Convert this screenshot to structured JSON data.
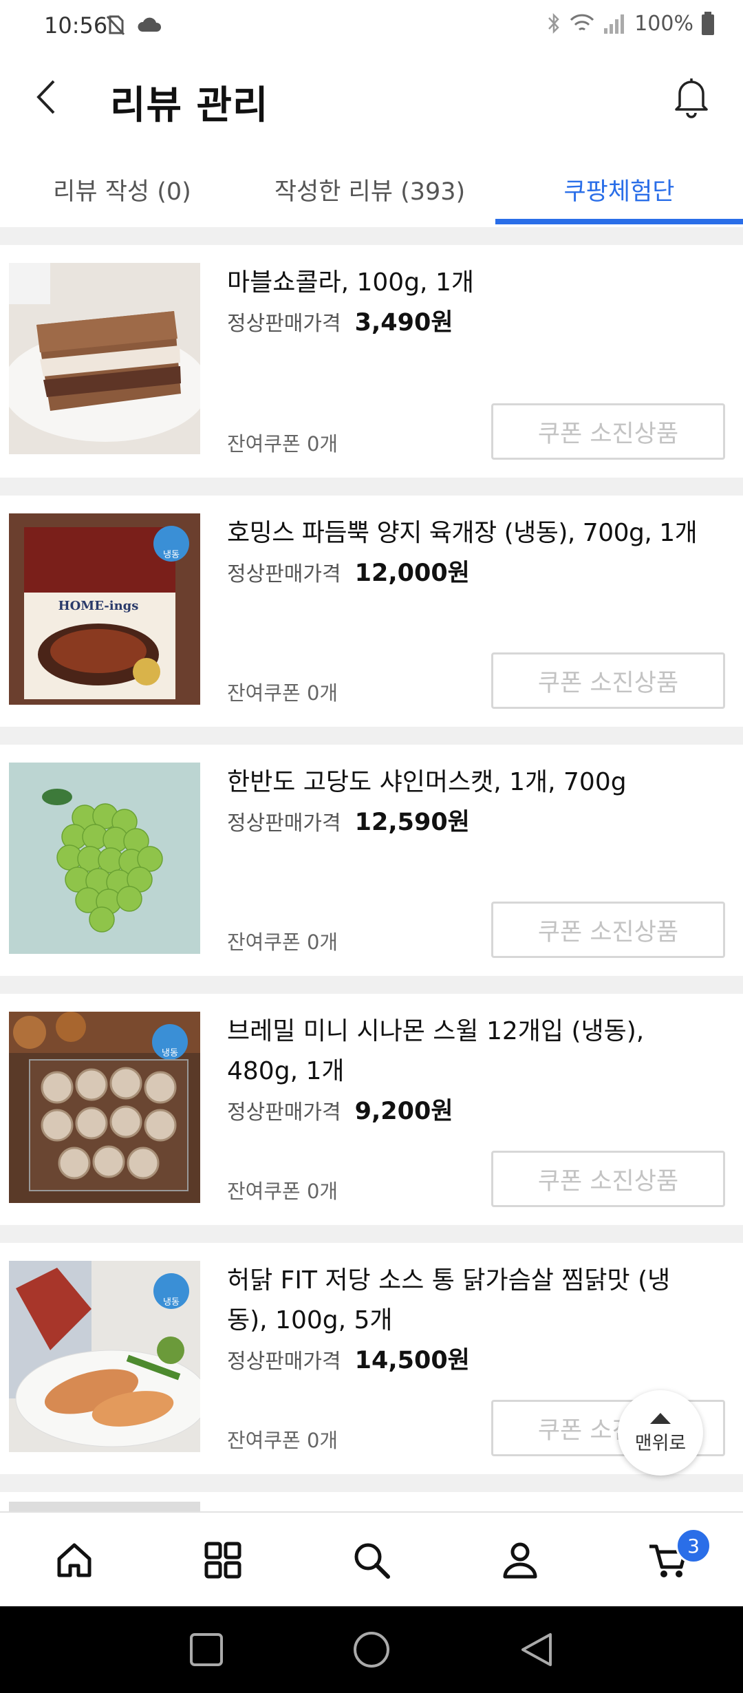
{
  "status_bar": {
    "time": "10:56",
    "battery": "100%"
  },
  "header": {
    "title": "리뷰 관리"
  },
  "tabs": [
    {
      "label": "리뷰 작성 (0)"
    },
    {
      "label": "작성한 리뷰 (393)"
    },
    {
      "label": "쿠팡체험단"
    }
  ],
  "active_tab": "쿠팡체험단",
  "accent_color": "#2a6ee8",
  "price_label": "정상판매가격",
  "items": [
    {
      "name": "마블쇼콜라, 100g, 1개",
      "price": "3,490원",
      "coupons": "잔여쿠폰 0개",
      "button": "쿠폰 소진상품"
    },
    {
      "name": "호밍스 파듬뿍 양지 육개장 (냉동), 700g, 1개",
      "price": "12,000원",
      "coupons": "잔여쿠폰 0개",
      "button": "쿠폰 소진상품",
      "image_text": "HOME-ings",
      "badge": "냉동"
    },
    {
      "name": "한반도 고당도 샤인머스캣, 1개, 700g",
      "price": "12,590원",
      "coupons": "잔여쿠폰 0개",
      "button": "쿠폰 소진상품"
    },
    {
      "name": "브레밀 미니 시나몬 스윌 12개입 (냉동), 480g, 1개",
      "price": "9,200원",
      "coupons": "잔여쿠폰 0개",
      "button": "쿠폰 소진상품",
      "badge": "냉동"
    },
    {
      "name": "허닭 FIT 저당 소스 통 닭가슴살 찜닭맛 (냉동), 100g, 5개",
      "price": "14,500원",
      "coupons": "잔여쿠폰 0개",
      "button": "쿠폰 소진상품",
      "badge": "냉동"
    }
  ],
  "scroll_top": {
    "label": "맨위로"
  },
  "bottom_nav": {
    "items": [
      "home-icon",
      "grid-icon",
      "search-icon",
      "user-icon",
      "cart-icon"
    ],
    "cart_count": "3"
  }
}
